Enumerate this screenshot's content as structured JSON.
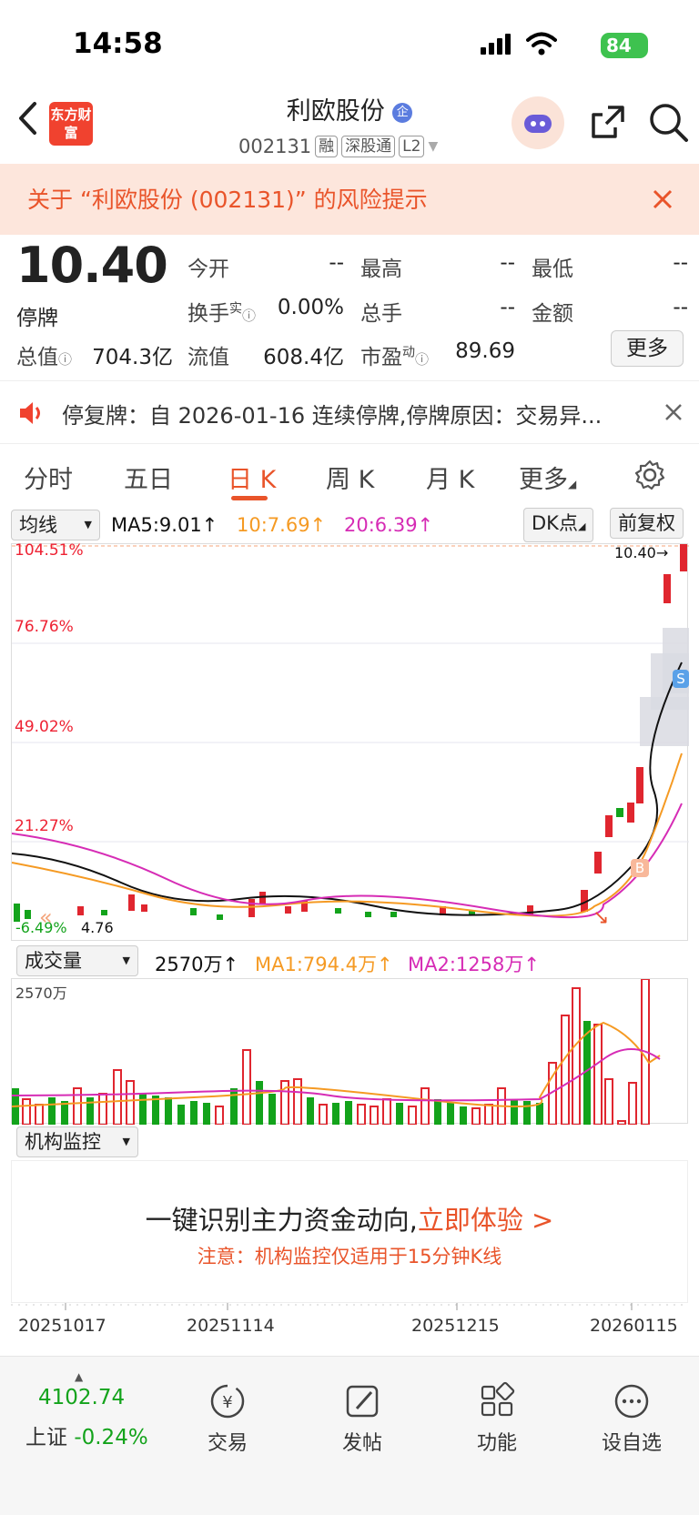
{
  "status_bar": {
    "time": "14:58",
    "battery": "84"
  },
  "header": {
    "brand": "东方财富",
    "stock_name": "利欧股份",
    "stock_code": "002131",
    "tags": [
      "融",
      "深股通",
      "L2"
    ]
  },
  "risk_alert": {
    "text": "关于 “利欧股份 (002131)” 的风险提示"
  },
  "quote": {
    "price": "10.40",
    "status": "停牌",
    "fields": [
      {
        "label": "今开",
        "value": "--"
      },
      {
        "label": "最高",
        "value": "--"
      },
      {
        "label": "最低",
        "value": "--"
      },
      {
        "label": "换手",
        "sup": "实",
        "value": "0.00%"
      },
      {
        "label": "总手",
        "value": "--"
      },
      {
        "label": "金额",
        "value": "--"
      },
      {
        "label": "总值",
        "value": "704.3亿"
      },
      {
        "label": "流值",
        "value": "608.4亿"
      },
      {
        "label": "市盈",
        "sup": "动",
        "value": "89.69"
      }
    ],
    "more_label": "更多"
  },
  "notice": {
    "text": "停复牌：自 2026-01-16 连续停牌,停牌原因：交易异..."
  },
  "tabs": [
    {
      "label": "分时"
    },
    {
      "label": "五日"
    },
    {
      "label": "日 K",
      "active": true
    },
    {
      "label": "周 K"
    },
    {
      "label": "月 K"
    },
    {
      "label": "更多"
    }
  ],
  "indicators": {
    "ma_select": "均线",
    "ma5": "MA5:9.01↑",
    "ma10": "10:7.69↑",
    "ma20": "20:6.39↑",
    "dk_button": "DK点",
    "adjust_button": "前复权",
    "pct_labels": [
      "104.51%",
      "76.76%",
      "49.02%",
      "21.27%"
    ],
    "high_label": "10.40",
    "low_pct": "-6.49%",
    "low_price": "4.76",
    "marker_b": "B",
    "marker_s": "S"
  },
  "volume": {
    "select": "成交量",
    "current": "2570万↑",
    "ma1": "MA1:794.4万↑",
    "ma2": "MA2:1258万↑",
    "axis_max": "2570万"
  },
  "institution": {
    "select": "机构监控",
    "headline": "一键识别主力资金动向,",
    "cta": "立即体验 >",
    "note": "注意：机构监控仅适用于15分钟K线"
  },
  "dates": [
    "20251017",
    "20251114",
    "20251215",
    "20260115"
  ],
  "bottom_bar": {
    "index_value": "4102.74",
    "index_name": "上证",
    "index_change": "-0.24%",
    "items": [
      {
        "label": "交易"
      },
      {
        "label": "发帖"
      },
      {
        "label": "功能"
      },
      {
        "label": "设自选"
      }
    ]
  },
  "colors": {
    "accent": "#e9542a",
    "up": "#e0262f",
    "down": "#13a31b",
    "ma5": "#111111",
    "ma10": "#f59a23",
    "ma20": "#d62cb5"
  },
  "chart_data": {
    "type": "candlestick",
    "y_axis_pct": [
      104.51,
      76.76,
      49.02,
      21.27,
      -6.49
    ],
    "last_close": 10.4,
    "min_price": 4.76,
    "ma": {
      "ma5": 9.01,
      "ma10": 7.69,
      "ma20": 6.39
    },
    "x_ticks": [
      "20251017",
      "20251114",
      "20251215",
      "20260115"
    ]
  }
}
